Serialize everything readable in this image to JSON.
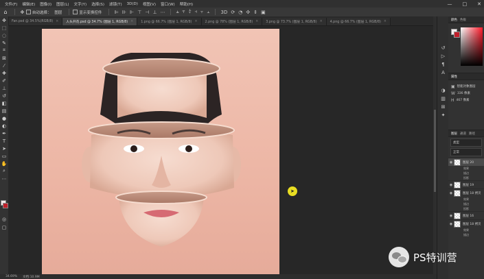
{
  "menubar": {
    "items": [
      "文件(F)",
      "编辑(E)",
      "图像(I)",
      "图层(L)",
      "文字(Y)",
      "选择(S)",
      "滤镜(T)",
      "3D(D)",
      "视图(V)",
      "窗口(W)",
      "帮助(H)"
    ],
    "window_controls": [
      "—",
      "□",
      "✕"
    ]
  },
  "options": {
    "home": "⌂",
    "move": "✥",
    "auto_select": "自动选择：",
    "layer_select": "图层",
    "show_transform": "显示变换控件"
  },
  "tabs": [
    {
      "label": "Fan.psd @ 34.5%(RGB/8)",
      "active": false
    },
    {
      "label": "人头开花.psd @ 34.7% (图层 1, RGB/8)",
      "active": true
    },
    {
      "label": "1.png @ 66.7% (图层 1, RGB/8)",
      "active": false
    },
    {
      "label": "2.png @ 78% (图层 1, RGB/8)",
      "active": false
    },
    {
      "label": "3.png @ 73.7% (图层 1, RGB/8)",
      "active": false
    },
    {
      "label": "4.png @ 66.7% (图层 1, RGB/8)",
      "active": false
    }
  ],
  "status": {
    "zoom": "34.69%",
    "doc": "文档:10.9M"
  },
  "panels": {
    "color_tabs": [
      "颜色",
      "色板"
    ],
    "properties_tab": "属性",
    "properties_rows": [
      {
        "icon": "▣",
        "label": "智能对象图层"
      },
      {
        "icon": "W",
        "label": "336 像素"
      },
      {
        "icon": "H",
        "label": "467 像素"
      }
    ],
    "layers_tabs": [
      "图层",
      "通道",
      "路径"
    ],
    "kind_filter": "类型",
    "blend_mode": "正常",
    "layers": [
      {
        "name": "图层 20",
        "selected": true,
        "effects": [
          "效果",
          "描边",
          "投影"
        ]
      },
      {
        "name": "图层 19",
        "selected": false,
        "effects": []
      },
      {
        "name": "图层 18 拷贝",
        "selected": false,
        "effects": [
          "效果",
          "描边",
          "投影"
        ]
      },
      {
        "name": "图层 16",
        "selected": false,
        "effects": []
      },
      {
        "name": "图层 18 拷贝",
        "selected": false,
        "effects": [
          "效果",
          "描边",
          "投影"
        ]
      }
    ]
  },
  "watermark": {
    "text": "PS特训营"
  }
}
